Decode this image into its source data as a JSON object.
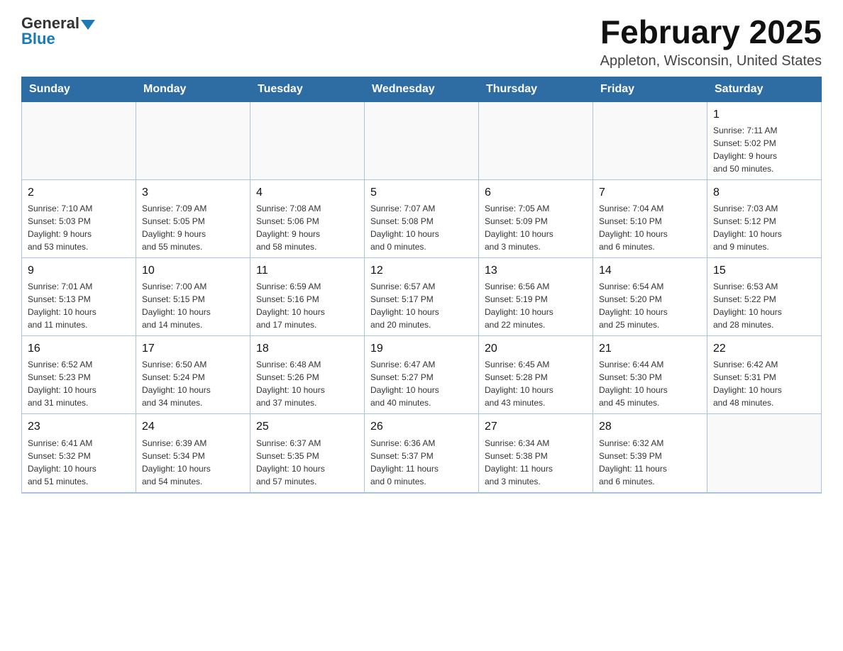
{
  "logo": {
    "general": "General",
    "blue": "Blue"
  },
  "title": "February 2025",
  "subtitle": "Appleton, Wisconsin, United States",
  "days_of_week": [
    "Sunday",
    "Monday",
    "Tuesday",
    "Wednesday",
    "Thursday",
    "Friday",
    "Saturday"
  ],
  "weeks": [
    [
      {
        "day": "",
        "info": ""
      },
      {
        "day": "",
        "info": ""
      },
      {
        "day": "",
        "info": ""
      },
      {
        "day": "",
        "info": ""
      },
      {
        "day": "",
        "info": ""
      },
      {
        "day": "",
        "info": ""
      },
      {
        "day": "1",
        "info": "Sunrise: 7:11 AM\nSunset: 5:02 PM\nDaylight: 9 hours\nand 50 minutes."
      }
    ],
    [
      {
        "day": "2",
        "info": "Sunrise: 7:10 AM\nSunset: 5:03 PM\nDaylight: 9 hours\nand 53 minutes."
      },
      {
        "day": "3",
        "info": "Sunrise: 7:09 AM\nSunset: 5:05 PM\nDaylight: 9 hours\nand 55 minutes."
      },
      {
        "day": "4",
        "info": "Sunrise: 7:08 AM\nSunset: 5:06 PM\nDaylight: 9 hours\nand 58 minutes."
      },
      {
        "day": "5",
        "info": "Sunrise: 7:07 AM\nSunset: 5:08 PM\nDaylight: 10 hours\nand 0 minutes."
      },
      {
        "day": "6",
        "info": "Sunrise: 7:05 AM\nSunset: 5:09 PM\nDaylight: 10 hours\nand 3 minutes."
      },
      {
        "day": "7",
        "info": "Sunrise: 7:04 AM\nSunset: 5:10 PM\nDaylight: 10 hours\nand 6 minutes."
      },
      {
        "day": "8",
        "info": "Sunrise: 7:03 AM\nSunset: 5:12 PM\nDaylight: 10 hours\nand 9 minutes."
      }
    ],
    [
      {
        "day": "9",
        "info": "Sunrise: 7:01 AM\nSunset: 5:13 PM\nDaylight: 10 hours\nand 11 minutes."
      },
      {
        "day": "10",
        "info": "Sunrise: 7:00 AM\nSunset: 5:15 PM\nDaylight: 10 hours\nand 14 minutes."
      },
      {
        "day": "11",
        "info": "Sunrise: 6:59 AM\nSunset: 5:16 PM\nDaylight: 10 hours\nand 17 minutes."
      },
      {
        "day": "12",
        "info": "Sunrise: 6:57 AM\nSunset: 5:17 PM\nDaylight: 10 hours\nand 20 minutes."
      },
      {
        "day": "13",
        "info": "Sunrise: 6:56 AM\nSunset: 5:19 PM\nDaylight: 10 hours\nand 22 minutes."
      },
      {
        "day": "14",
        "info": "Sunrise: 6:54 AM\nSunset: 5:20 PM\nDaylight: 10 hours\nand 25 minutes."
      },
      {
        "day": "15",
        "info": "Sunrise: 6:53 AM\nSunset: 5:22 PM\nDaylight: 10 hours\nand 28 minutes."
      }
    ],
    [
      {
        "day": "16",
        "info": "Sunrise: 6:52 AM\nSunset: 5:23 PM\nDaylight: 10 hours\nand 31 minutes."
      },
      {
        "day": "17",
        "info": "Sunrise: 6:50 AM\nSunset: 5:24 PM\nDaylight: 10 hours\nand 34 minutes."
      },
      {
        "day": "18",
        "info": "Sunrise: 6:48 AM\nSunset: 5:26 PM\nDaylight: 10 hours\nand 37 minutes."
      },
      {
        "day": "19",
        "info": "Sunrise: 6:47 AM\nSunset: 5:27 PM\nDaylight: 10 hours\nand 40 minutes."
      },
      {
        "day": "20",
        "info": "Sunrise: 6:45 AM\nSunset: 5:28 PM\nDaylight: 10 hours\nand 43 minutes."
      },
      {
        "day": "21",
        "info": "Sunrise: 6:44 AM\nSunset: 5:30 PM\nDaylight: 10 hours\nand 45 minutes."
      },
      {
        "day": "22",
        "info": "Sunrise: 6:42 AM\nSunset: 5:31 PM\nDaylight: 10 hours\nand 48 minutes."
      }
    ],
    [
      {
        "day": "23",
        "info": "Sunrise: 6:41 AM\nSunset: 5:32 PM\nDaylight: 10 hours\nand 51 minutes."
      },
      {
        "day": "24",
        "info": "Sunrise: 6:39 AM\nSunset: 5:34 PM\nDaylight: 10 hours\nand 54 minutes."
      },
      {
        "day": "25",
        "info": "Sunrise: 6:37 AM\nSunset: 5:35 PM\nDaylight: 10 hours\nand 57 minutes."
      },
      {
        "day": "26",
        "info": "Sunrise: 6:36 AM\nSunset: 5:37 PM\nDaylight: 11 hours\nand 0 minutes."
      },
      {
        "day": "27",
        "info": "Sunrise: 6:34 AM\nSunset: 5:38 PM\nDaylight: 11 hours\nand 3 minutes."
      },
      {
        "day": "28",
        "info": "Sunrise: 6:32 AM\nSunset: 5:39 PM\nDaylight: 11 hours\nand 6 minutes."
      },
      {
        "day": "",
        "info": ""
      }
    ]
  ]
}
